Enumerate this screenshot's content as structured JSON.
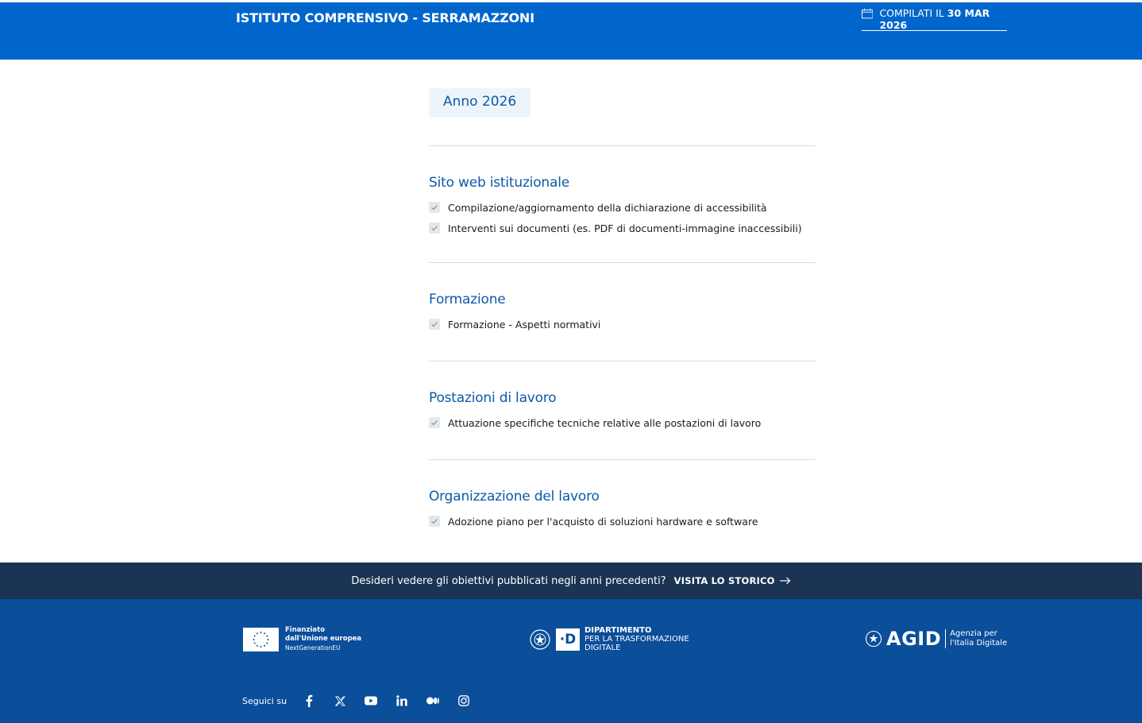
{
  "header": {
    "title": "ISTITUTO COMPRENSIVO - SERRAMAZZONI",
    "compiled_prefix": "COMPILATI IL ",
    "compiled_date": "30 MAR 2026"
  },
  "year": {
    "label": "Anno ",
    "value": "2026"
  },
  "sections": [
    {
      "title": "Sito web istituzionale",
      "items": [
        "Compilazione/aggiornamento della dichiarazione di accessibilità",
        "Interventi sui documenti (es. PDF di documenti-immagine inaccessibili)"
      ]
    },
    {
      "title": "Formazione",
      "items": [
        "Formazione - Aspetti normativi"
      ]
    },
    {
      "title": "Postazioni di lavoro",
      "items": [
        "Attuazione specifiche tecniche relative alle postazioni di lavoro"
      ]
    },
    {
      "title": "Organizzazione del lavoro",
      "items": [
        "Adozione piano per l'acquisto di soluzioni hardware e software"
      ]
    }
  ],
  "history": {
    "question": "Desideri vedere gli obiettivi pubblicati negli anni precedenti?",
    "link": "VISITA LO STORICO"
  },
  "footer": {
    "eu": {
      "line1": "Finanziato",
      "line2": "dall'Unione europea",
      "line3": "NextGenerationEU"
    },
    "dtd": {
      "letter": "·D",
      "line1": "DIPARTIMENTO",
      "line2": "PER LA TRASFORMAZIONE",
      "line3": "DIGITALE"
    },
    "agid": {
      "word": "AGID",
      "line1": "Agenzia per",
      "line2": "l'Italia Digitale"
    },
    "social_label": "Seguici su",
    "social_icons": [
      "facebook-icon",
      "x-icon",
      "youtube-icon",
      "linkedin-icon",
      "medium-icon",
      "instagram-icon"
    ]
  },
  "colors": {
    "header_blue": "#0066cc",
    "heading_blue": "#0b5aa8",
    "history_bar": "#1b3453",
    "footer_blue": "#0b4e9a"
  }
}
